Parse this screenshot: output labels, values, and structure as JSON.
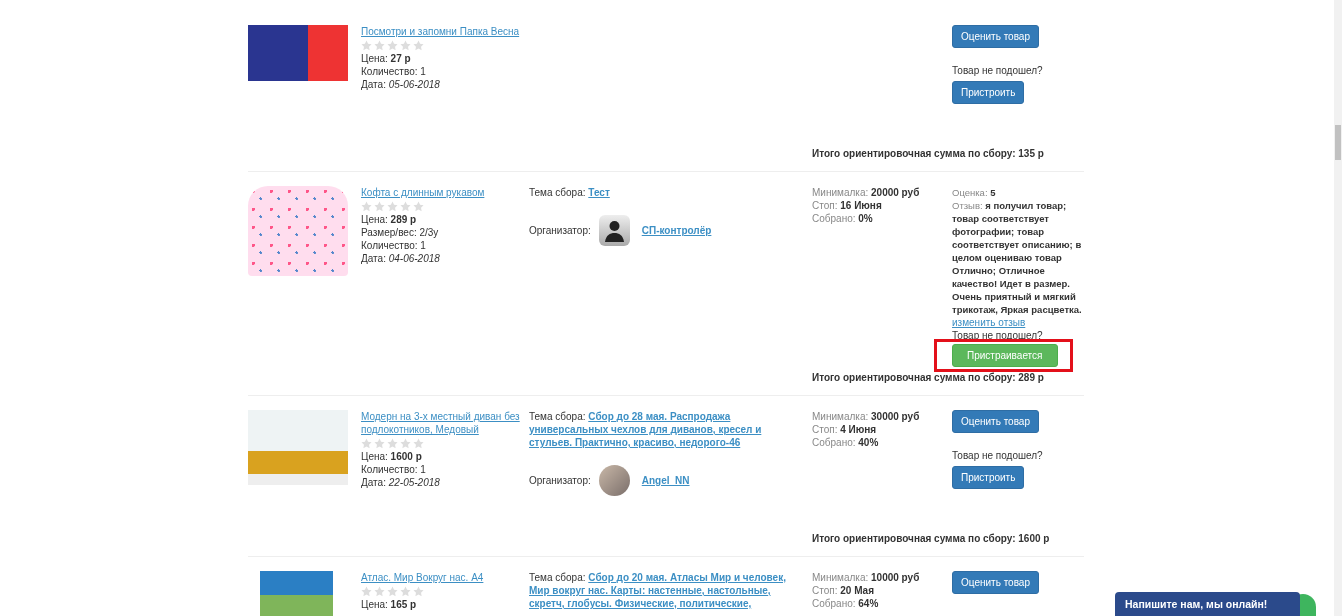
{
  "orders": [
    {
      "title": "Посмотри и запомни Папка Весна",
      "stars": 0,
      "details": [
        {
          "kind": "price",
          "label": "Цена:",
          "value": "27 р"
        },
        {
          "kind": "plain",
          "label": "Количество:",
          "value": "1"
        },
        {
          "kind": "date",
          "label": "Дата:",
          "value": "05-06-2018"
        }
      ],
      "actions": [
        {
          "kind": "button",
          "label": "Оценить товар"
        },
        {
          "kind": "text",
          "text": "Товар не подошел?"
        },
        {
          "kind": "button",
          "label": "Пристроить"
        }
      ],
      "total": "Итого ориентировочная сумма по сбору: 135 р"
    },
    {
      "title": "Кофта с длинным рукавом",
      "stars": 0,
      "details": [
        {
          "kind": "price",
          "label": "Цена:",
          "value": "289 р"
        },
        {
          "kind": "plain",
          "label": "Размер/вес:",
          "value": "2/3y"
        },
        {
          "kind": "plain",
          "label": "Количество:",
          "value": "1"
        },
        {
          "kind": "date",
          "label": "Дата:",
          "value": "04-06-2018"
        }
      ],
      "collection": {
        "label": "Тема сбора:",
        "topic": "Тест",
        "organizer_label": "Организатор:",
        "organizer": "СП-контролёр"
      },
      "stats": [
        {
          "label": "Минималка:",
          "value": "20000 руб"
        },
        {
          "label": "Стоп:",
          "value": "16 Июня"
        },
        {
          "label": "Собрано:",
          "value": "0%"
        }
      ],
      "actions": [
        {
          "kind": "labeled",
          "label": "Оценка:",
          "value": "5"
        },
        {
          "kind": "labeled",
          "label": "Отзыв:",
          "value": "я получил товар; товар соответствует фотографии; товар соответствует описанию; в целом оцениваю товар Отлично; Отличное качество! Идет в размер. Очень приятный и мягкий трикотаж, Яркая расцветка."
        },
        {
          "kind": "link",
          "text": "изменить отзыв"
        },
        {
          "kind": "text",
          "text": "Товар не подошел?"
        },
        {
          "kind": "status_button",
          "label": "Пристраивается",
          "highlighted": true
        }
      ],
      "total": "Итого ориентировочная сумма по сбору: 289 р"
    },
    {
      "title": "Модерн на 3-х местный диван без подлокотников, Медовый",
      "stars": 0,
      "details": [
        {
          "kind": "price",
          "label": "Цена:",
          "value": "1600 р"
        },
        {
          "kind": "plain",
          "label": "Количество:",
          "value": "1"
        },
        {
          "kind": "date",
          "label": "Дата:",
          "value": "22-05-2018"
        }
      ],
      "collection": {
        "label": "Тема сбора:",
        "topic": "Сбор до 28 мая. Распродажа универсальных чехлов для диванов, кресел и стульев. Практично, красиво, недорого-46",
        "organizer_label": "Организатор:",
        "organizer": "Angel_NN"
      },
      "stats": [
        {
          "label": "Минималка:",
          "value": "30000 руб"
        },
        {
          "label": "Стоп:",
          "value": "4 Июня"
        },
        {
          "label": "Собрано:",
          "value": "40%"
        }
      ],
      "actions": [
        {
          "kind": "button",
          "label": "Оценить товар"
        },
        {
          "kind": "text",
          "text": "Товар не подошел?"
        },
        {
          "kind": "button",
          "label": "Пристроить"
        }
      ],
      "total": "Итого ориентировочная сумма по сбору: 1600 р"
    },
    {
      "title": "Атлас. Мир Вокруг нас. А4",
      "stars": 0,
      "details": [
        {
          "kind": "price",
          "label": "Цена:",
          "value": "165 р"
        }
      ],
      "collection": {
        "label": "Тема сбора:",
        "topic": "Сбор до 20 мая. Атласы Мир и человек, Мир вокруг нас. Карты: настенные, настольные, скретч, глобусы. Физические, политические,"
      },
      "stats": [
        {
          "label": "Минималка:",
          "value": "10000 руб"
        },
        {
          "label": "Стоп:",
          "value": "20 Мая"
        },
        {
          "label": "Собрано:",
          "value": "64%"
        }
      ],
      "actions": [
        {
          "kind": "button",
          "label": "Оценить товар"
        }
      ]
    }
  ],
  "chat": {
    "label": "Напишите нам, мы онлайн!"
  }
}
